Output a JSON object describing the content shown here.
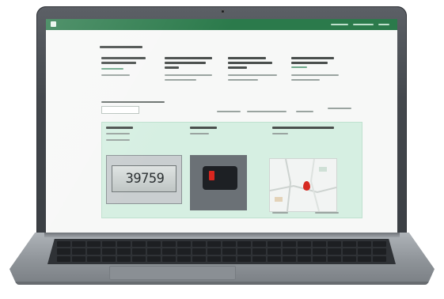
{
  "screen": {
    "meter_reading": "39759"
  },
  "colors": {
    "app_bar": "#2b7a4b",
    "panel": "#d6efe2",
    "laptop_body": "#9da2a7",
    "keyboard": "#2f3236"
  },
  "icons": [
    "app-logo-icon",
    "map-pin-icon",
    "camera-lens-icon"
  ]
}
